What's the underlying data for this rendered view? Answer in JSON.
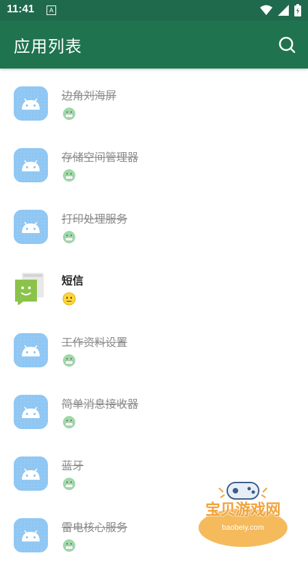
{
  "status_bar": {
    "time": "11:41",
    "indicator": "A",
    "icons": [
      "wifi-icon",
      "signal-icon",
      "battery-icon"
    ]
  },
  "app_bar": {
    "title": "应用列表",
    "action_icon": "search-icon",
    "color": "#20734f"
  },
  "apps": [
    {
      "name": "边角刘海屏",
      "icon": "android-icon",
      "emoji": "mask-face",
      "disabled": true
    },
    {
      "name": "存储空间管理器",
      "icon": "android-icon",
      "emoji": "mask-face",
      "disabled": true
    },
    {
      "name": "打印处理服务",
      "icon": "android-icon",
      "emoji": "mask-face",
      "disabled": true
    },
    {
      "name": "短信",
      "icon": "messages-icon",
      "emoji": "neutral-face",
      "disabled": false
    },
    {
      "name": "工作资料设置",
      "icon": "android-icon",
      "emoji": "mask-face",
      "disabled": true
    },
    {
      "name": "简单消息接收器",
      "icon": "android-icon",
      "emoji": "mask-face",
      "disabled": true
    },
    {
      "name": "蓝牙",
      "icon": "android-icon",
      "emoji": "mask-face",
      "disabled": true
    },
    {
      "name": "雷电核心服务",
      "icon": "android-icon",
      "emoji": "mask-face",
      "disabled": true
    }
  ],
  "watermark": {
    "title": "宝贝游戏网",
    "url": "baobeiy.com"
  }
}
